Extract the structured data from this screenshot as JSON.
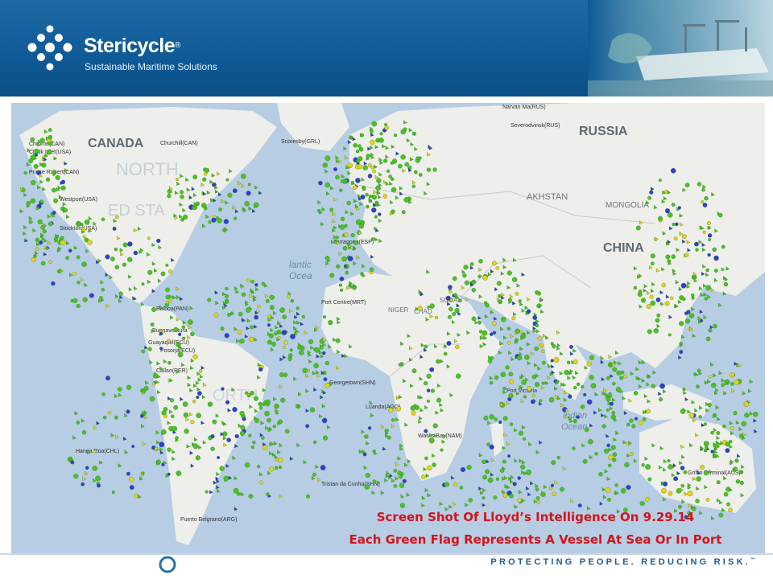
{
  "header": {
    "brand": "Stericycle",
    "registered": "®",
    "tagline": "Sustainable Maritime Solutions"
  },
  "map": {
    "labels": {
      "canada": "CANADA",
      "north_america": "NORTH",
      "states": "ED STA",
      "russia": "RUSSIA",
      "kazakhstan": "AKHSTAN",
      "mongolia": "MONGOLIA",
      "china": "CHINA",
      "atlantic": "lantic",
      "ocean_atl": "Ocea",
      "niger": "NIGER",
      "chad": "CHAD",
      "sudan": "SUDAN",
      "south_america": "ORTH",
      "indian": "Indian",
      "ocean_ind": "Ocean"
    },
    "ports": {
      "p1": "Chrome(CAN)",
      "p2": "Chalk Inlet(USA)",
      "p3": "Churchill(CAN)",
      "p4": "Prince Rupert(CAN)",
      "p5": "Westport(USA)",
      "p6": "Stockton(USA)",
      "p7": "Balboa(PAN)",
      "p8": "Buenaventura",
      "p9": "Guayaquil(ECU)",
      "p10": "Posorja(ECU)",
      "p11": "Callao(PER)",
      "p12": "Hanga Roa(CHL)",
      "p13": "Puerto Belgrano(ARG)",
      "p14": "Tristan da Cunha(SHN)",
      "p15": "Walvis Bay(NAM)",
      "p16": "Port Victoria",
      "p17": "Griffin Terminal(AUS)",
      "p18": "Narvan Ma(RUS)",
      "p19": "Severodvinsk(RUS)",
      "p20": "Scoresby(GRL)",
      "p21": "Port Centre(MRT)",
      "p22": "Georgetown(SHN)",
      "p23": "Luanda(AGO)",
      "p24": "Tarragona(ESP)"
    }
  },
  "caption": {
    "line1": "Screen Shot Of Lloyd’s Intelligence On 9.29.14",
    "line2": "Each Green Flag Represents A Vessel At Sea Or In Port"
  },
  "footer": {
    "slogan": "PROTECTING PEOPLE. REDUCING RISK.",
    "trademark": "™"
  },
  "colors": {
    "header_blue": "#0e5a96",
    "ocean": "#b6cde4",
    "land": "#eeeeea",
    "vessel_green": "#49c225",
    "vessel_yellow": "#e4d21c",
    "vessel_blue": "#2f3fd1",
    "caption_red": "#d4141b",
    "slogan_blue": "#1b5d96"
  }
}
